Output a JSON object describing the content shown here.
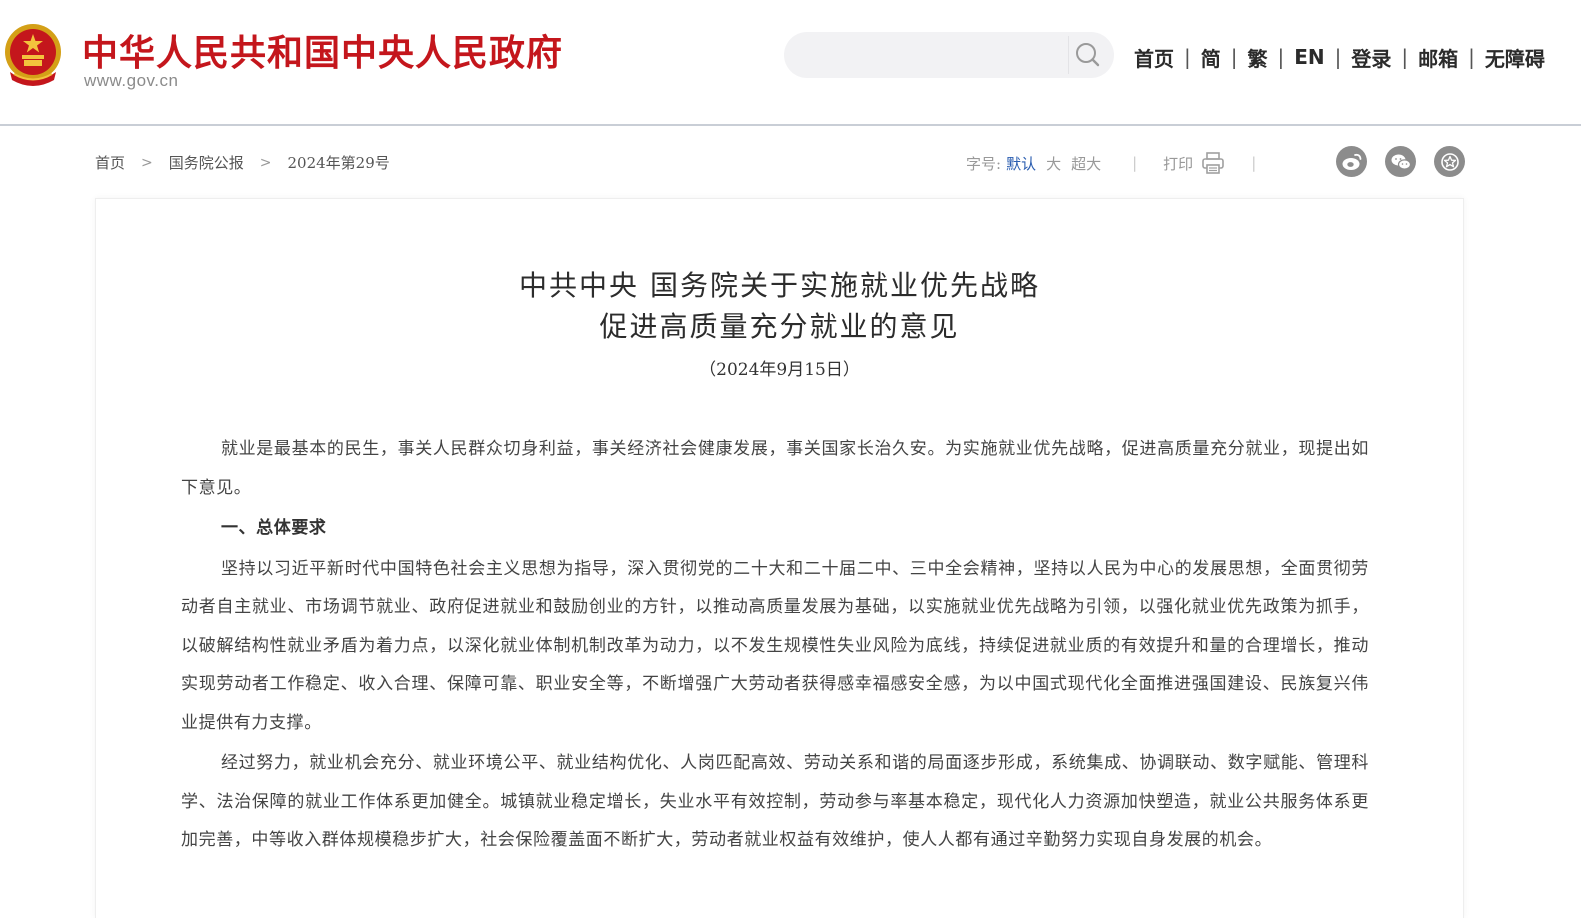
{
  "header": {
    "site_title": "中华人民共和国中央人民政府",
    "site_url": "www.gov.cn",
    "search_placeholder": "",
    "nav": [
      {
        "label": "首页"
      },
      {
        "label": "简"
      },
      {
        "label": "繁"
      },
      {
        "label": "EN"
      },
      {
        "label": "登录"
      },
      {
        "label": "邮箱"
      },
      {
        "label": "无障碍"
      }
    ],
    "nav_separator": "|"
  },
  "breadcrumb": {
    "items": [
      "首页",
      "国务院公报",
      "2024年第29号"
    ],
    "separator": ">"
  },
  "toolbar": {
    "font_size_label": "字号:",
    "font_options": [
      "默认",
      "大",
      "超大"
    ],
    "active_font_option": "默认",
    "print_label": "打印",
    "separator": "|",
    "share_icons": [
      "weibo-icon",
      "wechat-icon",
      "favorite-icon"
    ]
  },
  "article": {
    "title_line1": "中共中央  国务院关于实施就业优先战略",
    "title_line2": "促进高质量充分就业的意见",
    "date": "（2024年9月15日）",
    "paragraphs": [
      "就业是最基本的民生，事关人民群众切身利益，事关经济社会健康发展，事关国家长治久安。为实施就业优先战略，促进高质量充分就业，现提出如下意见。",
      "一、总体要求",
      "坚持以习近平新时代中国特色社会主义思想为指导，深入贯彻党的二十大和二十届二中、三中全会精神，坚持以人民为中心的发展思想，全面贯彻劳动者自主就业、市场调节就业、政府促进就业和鼓励创业的方针，以推动高质量发展为基础，以实施就业优先战略为引领，以强化就业优先政策为抓手，以破解结构性就业矛盾为着力点，以深化就业体制机制改革为动力，以不发生规模性失业风险为底线，持续促进就业质的有效提升和量的合理增长，推动实现劳动者工作稳定、收入合理、保障可靠、职业安全等，不断增强广大劳动者获得感幸福感安全感，为以中国式现代化全面推进强国建设、民族复兴伟业提供有力支撑。",
      "经过努力，就业机会充分、就业环境公平、就业结构优化、人岗匹配高效、劳动关系和谐的局面逐步形成，系统集成、协调联动、数字赋能、管理科学、法治保障的就业工作体系更加健全。城镇就业稳定增长，失业水平有效控制，劳动参与率基本稳定，现代化人力资源加快塑造，就业公共服务体系更加完善，中等收入群体规模稳步扩大，社会保险覆盖面不断扩大，劳动者就业权益有效维护，使人人都有通过辛勤努力实现自身发展的机会。"
    ]
  },
  "colors": {
    "brand_red": "#c4161c",
    "link_blue": "#2a5db0",
    "icon_gray": "#8c8c8c"
  }
}
